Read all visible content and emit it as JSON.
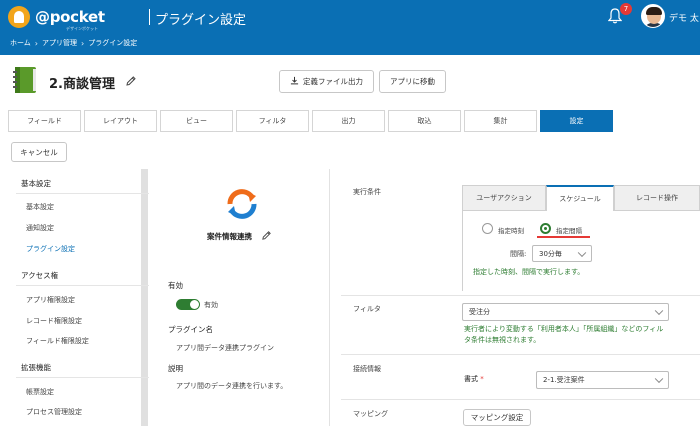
{
  "header": {
    "logo_text": "@pocket",
    "logo_sub": "デザインポケット",
    "title": "プラグイン設定",
    "breadcrumb": [
      "ホーム",
      "アプリ管理",
      "プラグイン設定"
    ],
    "notification_count": "7",
    "user_name": "デモ 太",
    "brand_color": "#0a6fb4"
  },
  "app": {
    "name": "2.商談管理",
    "export_button": "定義ファイル出力",
    "goto_app_button": "アプリに移動"
  },
  "tabs": [
    {
      "label": "フィールド",
      "active": false
    },
    {
      "label": "レイアウト",
      "active": false
    },
    {
      "label": "ビュー",
      "active": false
    },
    {
      "label": "フィルタ",
      "active": false
    },
    {
      "label": "出力",
      "active": false
    },
    {
      "label": "取込",
      "active": false
    },
    {
      "label": "集計",
      "active": false
    },
    {
      "label": "設定",
      "active": true
    }
  ],
  "cancel_button": "キャンセル",
  "sidebar": {
    "sections": [
      {
        "title": "基本設定",
        "items": [
          "基本設定",
          "通知設定",
          "プラグイン設定"
        ]
      },
      {
        "title": "アクセス権",
        "items": [
          "アプリ権限設定",
          "レコード権限設定",
          "フィールド権限設定"
        ]
      },
      {
        "title": "拡張機能",
        "items": [
          "帳票設定",
          "プロセス管理設定"
        ]
      }
    ],
    "active_item": "プラグイン設定"
  },
  "plugin": {
    "name": "案件情報連携",
    "enabled_label": "有効",
    "enabled_value": "有効",
    "enabled": true,
    "name_label": "プラグイン名",
    "name_value": "アプリ間データ連携プラグイン",
    "desc_label": "説明",
    "desc_value": "アプリ間のデータ連携を行います。"
  },
  "settings": {
    "exec_label": "実行条件",
    "exec_tabs": [
      {
        "label": "ユーザアクション",
        "active": false
      },
      {
        "label": "スケジュール",
        "active": true
      },
      {
        "label": "レコード操作",
        "active": false
      }
    ],
    "radio_options": [
      {
        "label": "指定時刻",
        "checked": false
      },
      {
        "label": "指定間隔",
        "checked": true
      }
    ],
    "interval_label": "間隔:",
    "interval_value": "30分毎",
    "schedule_hint": "指定した時刻、間隔で実行します。",
    "filter_label": "フィルタ",
    "filter_value": "受注分",
    "filter_hint_line1": "実行者により変動する「利用者本人」「所属組織」などのフィル",
    "filter_hint_line2": "タ条件は無視されます。",
    "connection_label": "接続情報",
    "format_label": "書式",
    "format_required": "*",
    "format_value": "2-1.受注案件",
    "mapping_label": "マッピング",
    "mapping_button": "マッピング設定"
  }
}
